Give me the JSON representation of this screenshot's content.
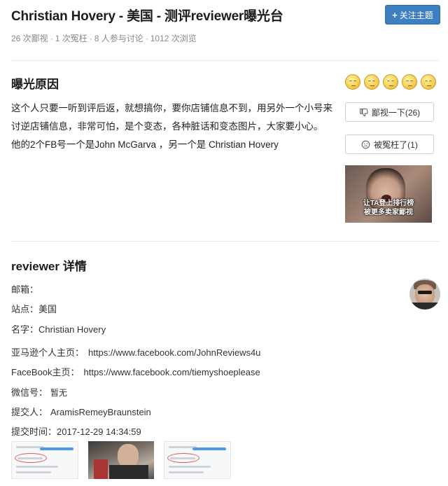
{
  "header": {
    "title": "Christian Hovery - 美国 - 测评reviewer曝光台",
    "follow_label": "关注主题",
    "stats": {
      "contempt": "26 次鄙视",
      "wronged": "1 次冤枉",
      "participants": "8 人参与讨论",
      "views": "1012 次浏览"
    }
  },
  "exposure": {
    "title": "曝光原因",
    "reasons": [
      "这个人只要一听到评后返，就想搞你，要你店铺信息不到，用另外一个小号来",
      "讨逆店铺信息，非常可怕，是个变态，各种脏话和变态图片，大家要小心。",
      "他的2个FB号一个是John McGarva ，另一个是 Christian Hovery"
    ],
    "contempt_button": "鄙视一下(26)",
    "wronged_button": "被冤枉了(1)",
    "meme_caption_1": "让TA登上排行榜",
    "meme_caption_2": "被更多卖家鄙视"
  },
  "details": {
    "title": "reviewer 详情",
    "email_label": "邮箱：",
    "email_value": "",
    "site_label": "站点：",
    "site_value": "美国",
    "name_label": "名字：",
    "name_value": "Christian Hovery",
    "amazon_label": "亚马逊个人主页：",
    "amazon_value": "https://www.facebook.com/JohnReviews4u",
    "facebook_label": "FaceBook主页：",
    "facebook_value": "https://www.facebook.com/tiemyshoeplease",
    "wechat_label": "微信号：",
    "wechat_value": "暂无",
    "submitter_label": "提交人：",
    "submitter_value": "AramisRemeyBraunstein",
    "time_label": "提交时间：",
    "time_value": "2017-12-29 14:34:59"
  },
  "icons": {
    "follow": "plus-icon",
    "contempt": "thumbs-down-icon",
    "wronged": "sad-face-icon",
    "rating": "emoji-face-icon"
  },
  "colors": {
    "accent": "#3d7fc1",
    "muted": "#888888"
  }
}
